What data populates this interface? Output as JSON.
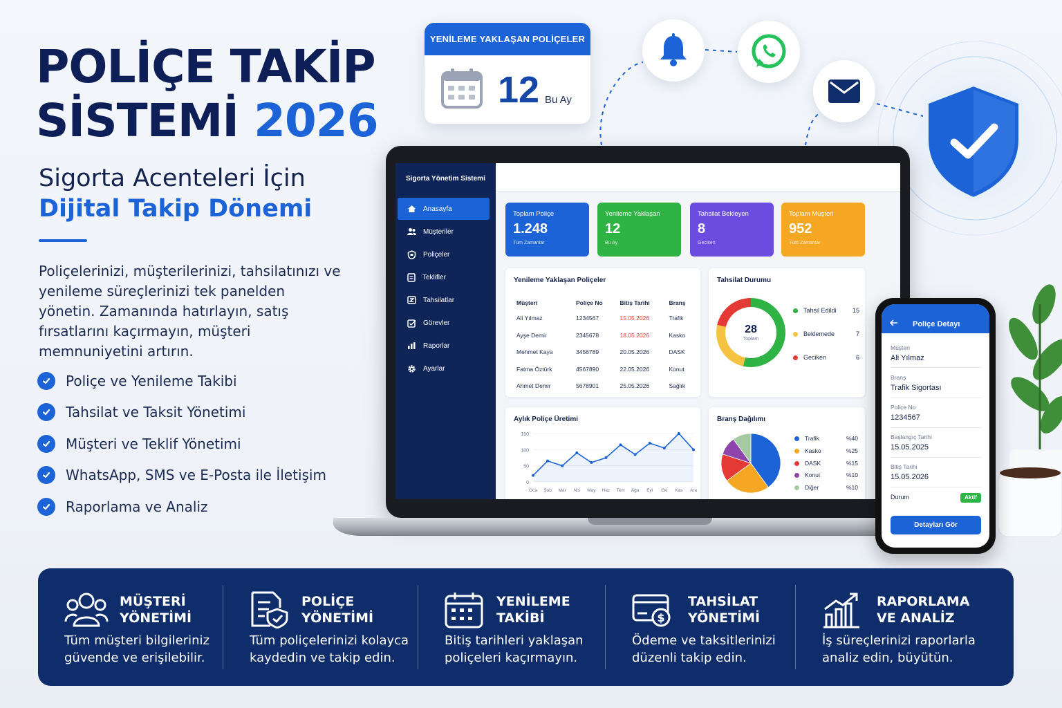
{
  "hero": {
    "title_line1": "POLİÇE TAKİP",
    "title_line2": "SİSTEMİ",
    "title_year": "2026",
    "subtitle_line1": "Sigorta Acenteleri İçin",
    "subtitle_line2": "Dijital Takip Dönemi",
    "description": "Poliçelerinizi, müşterilerinizi, tahsilatınızı ve yenileme süreçlerinizi tek panelden yönetin. Zamanında hatırlayın, satış fırsatlarını kaçırmayın, müşteri memnuniyetini artırın.",
    "features": [
      "Poliçe ve Yenileme Takibi",
      "Tahsilat ve Taksit Yönetimi",
      "Müşteri ve Teklif Yönetimi",
      "WhatsApp, SMS ve E-Posta ile İletişim",
      "Raporlama ve Analiz"
    ]
  },
  "calendar_card": {
    "header": "YENİLEME YAKLAŞAN POLİÇELER",
    "count": "12",
    "unit": "Bu Ay"
  },
  "notification_icons": [
    "bell-icon",
    "whatsapp-icon",
    "mail-icon",
    "shield-check-icon"
  ],
  "dashboard": {
    "sidebar_title": "Sigorta Yönetim Sistemi",
    "nav": [
      {
        "label": "Anasayfa",
        "icon": "home-icon",
        "active": true
      },
      {
        "label": "Müşteriler",
        "icon": "users-icon"
      },
      {
        "label": "Poliçeler",
        "icon": "policy-icon"
      },
      {
        "label": "Teklifler",
        "icon": "document-icon"
      },
      {
        "label": "Tahsilatlar",
        "icon": "payment-icon"
      },
      {
        "label": "Görevler",
        "icon": "task-icon"
      },
      {
        "label": "Raporlar",
        "icon": "chart-icon"
      },
      {
        "label": "Ayarlar",
        "icon": "gear-icon"
      }
    ],
    "kpis": [
      {
        "label": "Toplam Poliçe",
        "value": "1.248",
        "sub": "Tüm Zamanlar",
        "color": "#1c63d8"
      },
      {
        "label": "Yenileme Yaklaşan",
        "value": "12",
        "sub": "Bu Ay",
        "color": "#2fb344"
      },
      {
        "label": "Tahsilat Bekleyen",
        "value": "8",
        "sub": "Geciken",
        "color": "#6a4de0"
      },
      {
        "label": "Toplam Müşteri",
        "value": "952",
        "sub": "Tüm Zamanlar",
        "color": "#f5a623"
      }
    ],
    "renewals": {
      "title": "Yenileme Yaklaşan Poliçeler",
      "columns": [
        "Müşteri",
        "Poliçe No",
        "Bitiş Tarihi",
        "Branş"
      ],
      "rows": [
        {
          "customer": "Ali Yılmaz",
          "policy_no": "1234567",
          "end_date": "15.05.2026",
          "branch": "Trafik",
          "urgent": true
        },
        {
          "customer": "Ayşe Demir",
          "policy_no": "2345678",
          "end_date": "18.05.2026",
          "branch": "Kasko",
          "urgent": true
        },
        {
          "customer": "Mehmet Kaya",
          "policy_no": "3456789",
          "end_date": "20.05.2026",
          "branch": "DASK",
          "urgent": false
        },
        {
          "customer": "Fatma Öztürk",
          "policy_no": "4567890",
          "end_date": "22.05.2026",
          "branch": "Konut",
          "urgent": false
        },
        {
          "customer": "Ahmet Demir",
          "policy_no": "5678901",
          "end_date": "25.05.2026",
          "branch": "Sağlık",
          "urgent": false
        }
      ]
    },
    "collection": {
      "title": "Tahsilat Durumu",
      "total": "28",
      "total_label": "Toplam",
      "items": [
        {
          "label": "Tahsil Edildi",
          "value": 15,
          "color": "#2fb344"
        },
        {
          "label": "Beklemede",
          "value": 7,
          "color": "#f5c242"
        },
        {
          "label": "Geciken",
          "value": 6,
          "color": "#e53935"
        }
      ]
    },
    "monthly_title": "Aylık Poliçe Üretimi",
    "branch_title": "Branş Dağılımı",
    "branches": [
      {
        "label": "Trafik",
        "pct": "%40",
        "value": 40,
        "color": "#1c63d8"
      },
      {
        "label": "Kasko",
        "pct": "%25",
        "value": 25,
        "color": "#f5a623"
      },
      {
        "label": "DASK",
        "pct": "%15",
        "value": 15,
        "color": "#e53935"
      },
      {
        "label": "Konut",
        "pct": "%10",
        "value": 10,
        "color": "#8e44ad"
      },
      {
        "label": "Diğer",
        "pct": "%10",
        "value": 10,
        "color": "#a5c9a1"
      }
    ]
  },
  "chart_data": {
    "type": "line",
    "title": "Aylık Poliçe Üretimi",
    "x": [
      "Oca",
      "Şub",
      "Mar",
      "Nis",
      "May",
      "Haz",
      "Tem",
      "Ağu",
      "Eyl",
      "Eki",
      "Kas",
      "Ara"
    ],
    "y": [
      20,
      65,
      50,
      90,
      60,
      75,
      115,
      85,
      120,
      105,
      150,
      100
    ],
    "yticks": [
      0,
      50,
      100,
      150
    ],
    "ylim": [
      0,
      150
    ],
    "color": "#1c63d8"
  },
  "phone": {
    "title": "Poliçe Detayı",
    "fields": [
      {
        "key": "Müşteri",
        "value": "Ali Yılmaz"
      },
      {
        "key": "Branş",
        "value": "Trafik Sigortası"
      },
      {
        "key": "Poliçe No",
        "value": "1234567"
      },
      {
        "key": "Başlangıç Tarihi",
        "value": "15.05.2025"
      },
      {
        "key": "Bitiş Tarihi",
        "value": "15.05.2026"
      }
    ],
    "status_label": "Durum",
    "status_value": "Aktif",
    "button": "Detayları Gör"
  },
  "banner": [
    {
      "head1": "MÜŞTERİ",
      "head2": "YÖNETİMİ",
      "text1": "Tüm müşteri bilgileriniz",
      "text2": "güvende ve erişilebilir.",
      "icon": "users-icon"
    },
    {
      "head1": "POLİÇE",
      "head2": "YÖNETİMİ",
      "text1": "Tüm poliçelerinizi kolayca",
      "text2": "kaydedin ve takip edin.",
      "icon": "policy-shield-icon"
    },
    {
      "head1": "YENİLEME",
      "head2": "TAKİBİ",
      "text1": "Bitiş tarihleri yaklaşan",
      "text2": "poliçeleri kaçırmayın.",
      "icon": "calendar-icon"
    },
    {
      "head1": "TAHSİLAT",
      "head2": "YÖNETİMİ",
      "text1": "Ödeme ve taksitlerinizi",
      "text2": "düzenli takip edin.",
      "icon": "card-dollar-icon"
    },
    {
      "head1": "RAPORLAMA",
      "head2": "VE ANALİZ",
      "text1": "İş süreçlerinizi raporlarla",
      "text2": "analiz edin, büyütün.",
      "icon": "growth-chart-icon"
    }
  ]
}
